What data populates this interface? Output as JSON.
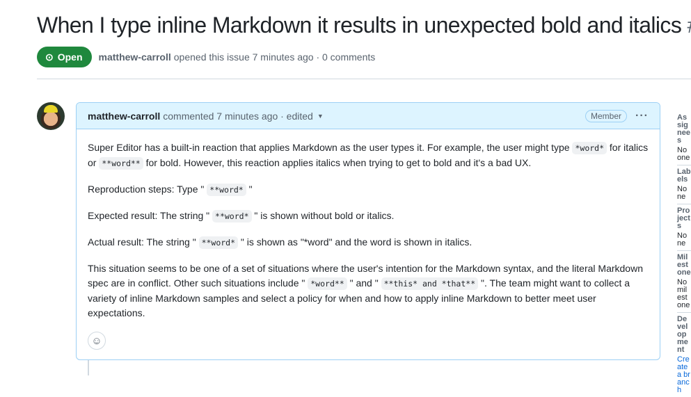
{
  "issue": {
    "title": "When I type inline Markdown it results in unexpected bold and italics",
    "number": "#",
    "status": "Open",
    "author": "matthew-carroll",
    "meta": "opened this issue 7 minutes ago · 0 comments"
  },
  "comment": {
    "author": "matthew-carroll",
    "meta": "commented 7 minutes ago · edited",
    "role": "Member",
    "p1a": "Super Editor has a built-in reaction that applies Markdown as the user types it. For example, the user might type ",
    "c1": "*word*",
    "p1b": " for italics or ",
    "c2": "**word**",
    "p1c": " for bold. However, this reaction applies italics when trying to get to bold and it's a bad UX.",
    "p2a": "Reproduction steps: Type \" ",
    "c3": "**word*",
    "p2b": " \"",
    "p3a": "Expected result: The string \" ",
    "c4": "**word*",
    "p3b": " \" is shown without bold or italics.",
    "p4a": "Actual result: The string \" ",
    "c5": "**word*",
    "p4b": " \" is shown as \"*word\" and the word is shown in italics.",
    "p5a": "This situation seems to be one of a set of situations where the user's intention for the Markdown syntax, and the literal Markdown spec are in conflict. Other such situations include \" ",
    "c6": "*word**",
    "p5b": " \" and \" ",
    "c7": "**this* and *that**",
    "p5c": " \". The team might want to collect a variety of inline Markdown samples and select a policy for when and how to apply inline Markdown to better meet user expectations."
  },
  "sidebar": [
    {
      "heading": "Assignees",
      "value": "No one"
    },
    {
      "heading": "Labels",
      "value": "None"
    },
    {
      "heading": "Projects",
      "value": "None"
    },
    {
      "heading": "Milestone",
      "value": "No milestone"
    },
    {
      "heading": "Development",
      "value": "Create a branch"
    }
  ]
}
